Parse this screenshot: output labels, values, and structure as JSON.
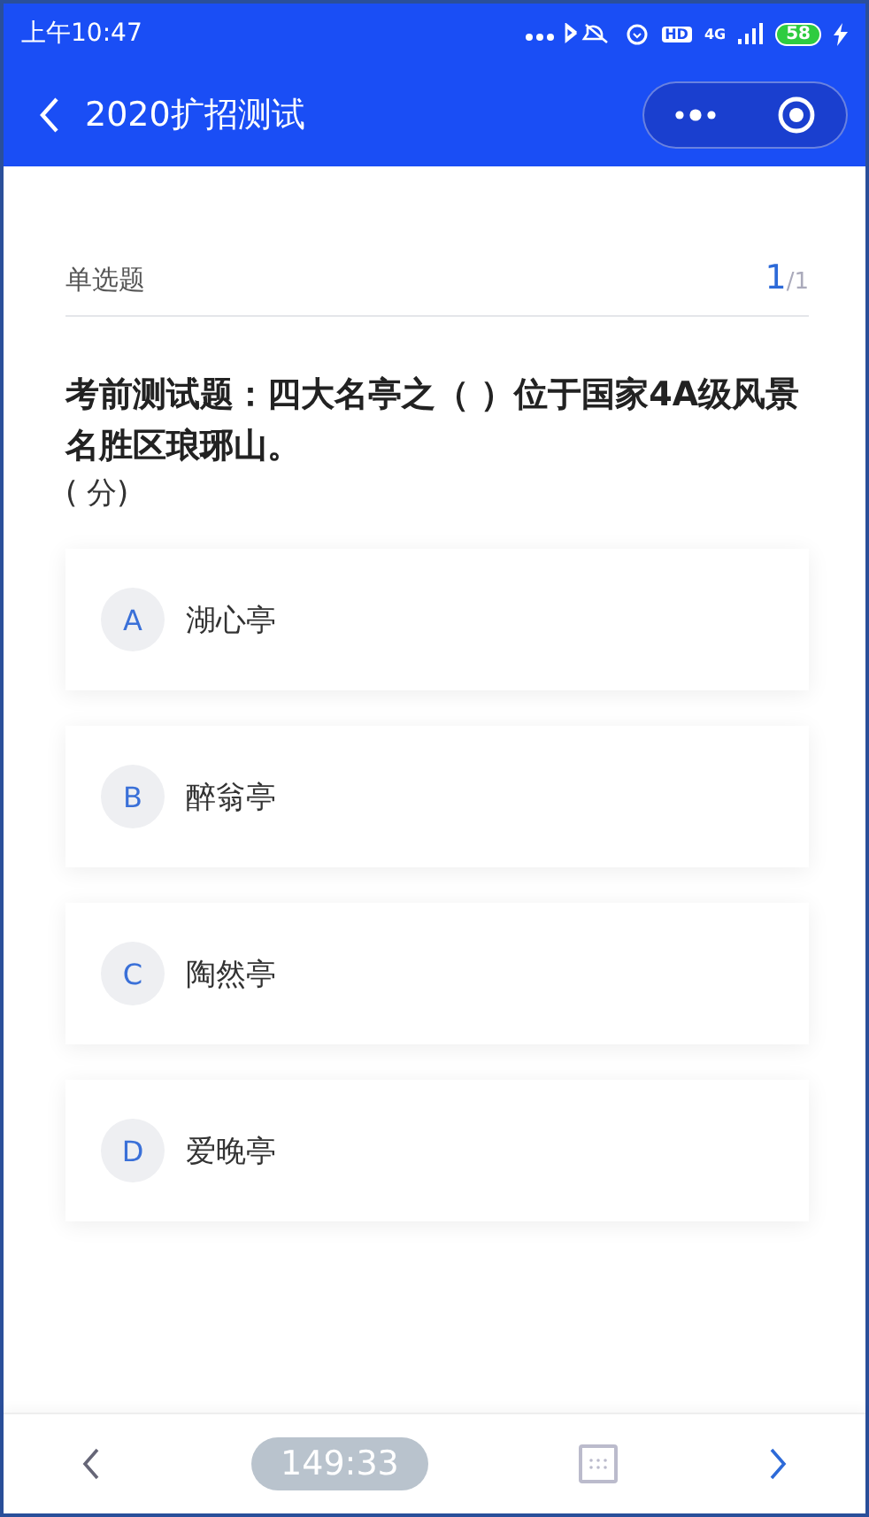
{
  "status_bar": {
    "time": "上午10:47",
    "hd": "HD",
    "network": "4G",
    "battery": "58"
  },
  "nav": {
    "title": "2020扩招测试"
  },
  "question": {
    "type": "单选题",
    "current": "1",
    "total": "/1",
    "text": "考前测试题：四大名亭之（ ）位于国家4A级风景名胜区琅琊山。",
    "score": "(     分)"
  },
  "options": [
    {
      "letter": "A",
      "text": "湖心亭",
      "selected": false
    },
    {
      "letter": "B",
      "text": "醉翁亭",
      "selected": false
    },
    {
      "letter": "C",
      "text": "陶然亭",
      "selected": false
    },
    {
      "letter": "D",
      "text": "爱晚亭",
      "selected": false
    }
  ],
  "footer": {
    "timer": "149:33"
  }
}
